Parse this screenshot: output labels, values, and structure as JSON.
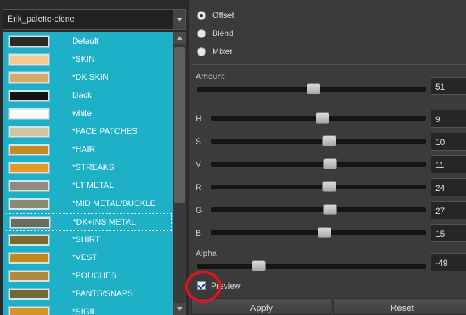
{
  "palette_selector": {
    "value": "Erik_palette-clone"
  },
  "palette_items": [
    {
      "label": "Default",
      "color": "#2a2b27"
    },
    {
      "label": "*SKIN",
      "color": "#f5c98f"
    },
    {
      "label": "*DK SKIN",
      "color": "#d6a96a"
    },
    {
      "label": "black",
      "color": "#121314"
    },
    {
      "label": "white",
      "color": "#fbfbfb"
    },
    {
      "label": "*FACE PATCHES",
      "color": "#cfc5a4"
    },
    {
      "label": "*HAIR",
      "color": "#c18a22"
    },
    {
      "label": "*STREAKS",
      "color": "#e39a2c"
    },
    {
      "label": "*LT METAL",
      "color": "#8f8a7b"
    },
    {
      "label": "*MID METAL/BUCKLE",
      "color": "#8c8a75"
    },
    {
      "label": "*DK+INS METAL",
      "color": "#6b6a5c"
    },
    {
      "label": "*SHIRT",
      "color": "#7a6a2c"
    },
    {
      "label": "*VEST",
      "color": "#c08a1a"
    },
    {
      "label": "*POUCHES",
      "color": "#b5893a"
    },
    {
      "label": "*PANTS/SNAPS",
      "color": "#6f6a33"
    },
    {
      "label": "*SIGIL",
      "color": "#d2932d"
    }
  ],
  "selected_item": "*DK+INS METAL",
  "mode_options": [
    {
      "label": "Offset",
      "checked": true
    },
    {
      "label": "Blend",
      "checked": false
    },
    {
      "label": "Mixer",
      "checked": false
    }
  ],
  "amount": {
    "label": "Amount",
    "value": "51",
    "level": 0.51
  },
  "channels": [
    {
      "label": "H",
      "value": "9",
      "level": 0.52
    },
    {
      "label": "S",
      "value": "10",
      "level": 0.55
    },
    {
      "label": "V",
      "value": "11",
      "level": 0.555
    },
    {
      "label": "R",
      "value": "24",
      "level": 0.55
    },
    {
      "label": "G",
      "value": "27",
      "level": 0.555
    },
    {
      "label": "B",
      "value": "15",
      "level": 0.53
    }
  ],
  "alpha": {
    "label": "Alpha",
    "value": "-49",
    "level": 0.27
  },
  "preview": {
    "label": "Preview",
    "checked": true
  },
  "buttons": {
    "apply": "Apply",
    "reset": "Reset"
  },
  "colors": {
    "list_background": "#1eb0c6",
    "highlight_ring": "#e0141b"
  }
}
